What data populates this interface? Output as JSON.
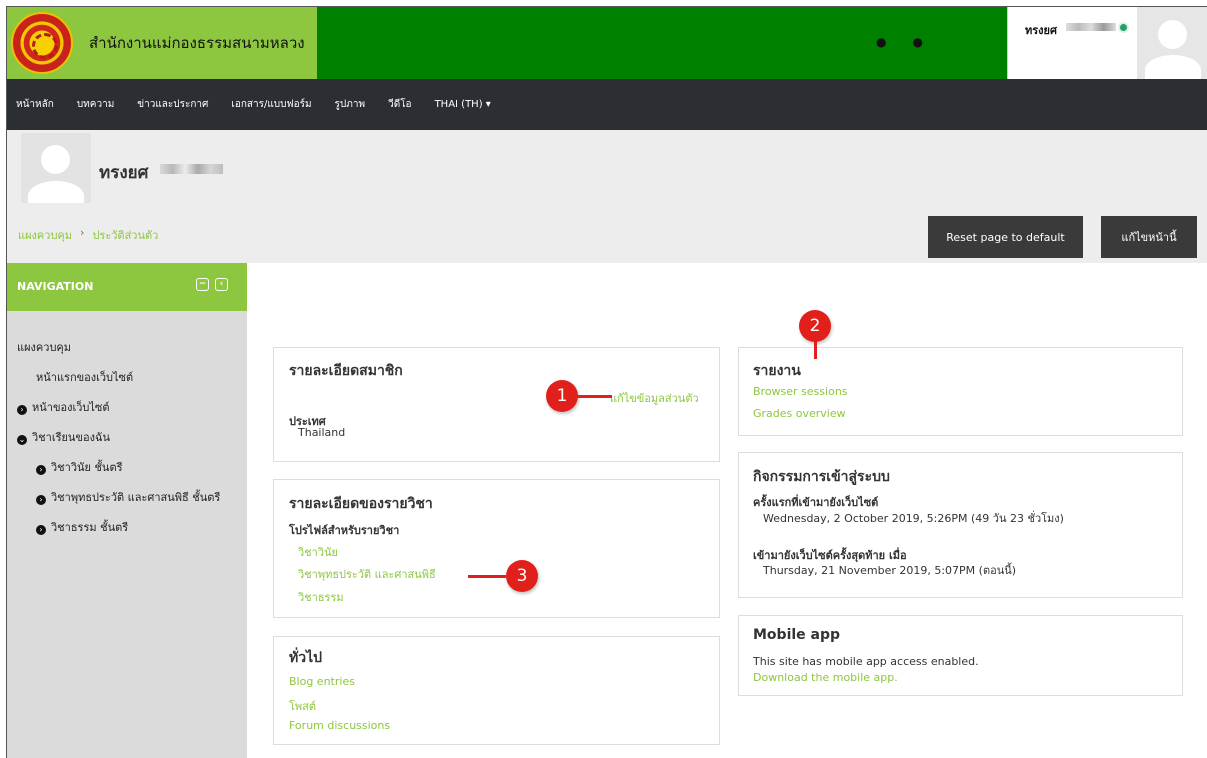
{
  "site": {
    "name": "สำนักงานแม่กองธรรมสนามหลวง"
  },
  "header": {
    "user_name": "ทรงยศ"
  },
  "nav": {
    "items": [
      "หน้าหลัก",
      "บทความ",
      "ข่าวและประกาศ",
      "เอกสาร/แบบฟอร์ม",
      "รูปภาพ",
      "วีดีโอ",
      "THAI (TH) ▾"
    ]
  },
  "profile": {
    "name": "ทรงยศ",
    "breadcrumb": [
      "แผงควบคุม",
      "ประวัติส่วนตัว"
    ],
    "reset_label": "Reset page to default",
    "edit_label": "แก้ไขหน้านี้"
  },
  "sidebar": {
    "title": "NAVIGATION",
    "items": [
      "แผงควบคุม",
      "หน้าแรกของเว็บไซต์",
      "หน้าของเว็บไซต์",
      "วิชาเรียนของฉัน",
      "วิชาวินัย ชั้นตรี",
      "วิชาพุทธประวัติ และศาสนพิธี ชั้นตรี",
      "วิชาธรรม ชั้นตรี"
    ]
  },
  "member": {
    "title": "รายละเอียดสมาชิก",
    "edit_link": "แก้ไขข้อมูลส่วนตัว",
    "country_label": "ประเทศ",
    "country": "Thailand"
  },
  "courses": {
    "title": "รายละเอียดของรายวิชา",
    "label": "โปรไฟล์สำหรับรายวิชา",
    "items": [
      "วิชาวินัย",
      "วิชาพุทธประวัติ และศาสนพิธี",
      "วิชาธรรม"
    ]
  },
  "general": {
    "title": "ทั่วไป",
    "links": [
      "Blog entries",
      "โพสต์",
      "Forum discussions"
    ]
  },
  "reports": {
    "title": "รายงาน",
    "links": [
      "Browser sessions",
      "Grades overview"
    ]
  },
  "activity": {
    "title": "กิจกรรมการเข้าสู่ระบบ",
    "first_label": "ครั้งแรกที่เข้ามายังเว็บไซต์",
    "first_value": "Wednesday, 2 October 2019, 5:26PM  (49 วัน 23 ชั่วโมง)",
    "last_label": "เข้ามายังเว็บไซต์ครั้งสุดท้าย เมื่อ",
    "last_value": "Thursday, 21 November 2019, 5:07PM  (ตอนนี้)"
  },
  "mobile": {
    "title": "Mobile app",
    "text": "This site has mobile app access enabled.",
    "link": "Download the mobile app."
  },
  "markers": [
    "1",
    "2",
    "3"
  ],
  "colors": {
    "accent": "#8dc63f",
    "header_green": "#008000",
    "nav_dark": "#2b2f33",
    "marker_red": "#e2201b"
  },
  "icons": [
    "bell-icon",
    "message-icon",
    "online-status-icon",
    "collapse-icon",
    "dock-icon",
    "chevron-right-icon",
    "chevron-down-icon"
  ]
}
